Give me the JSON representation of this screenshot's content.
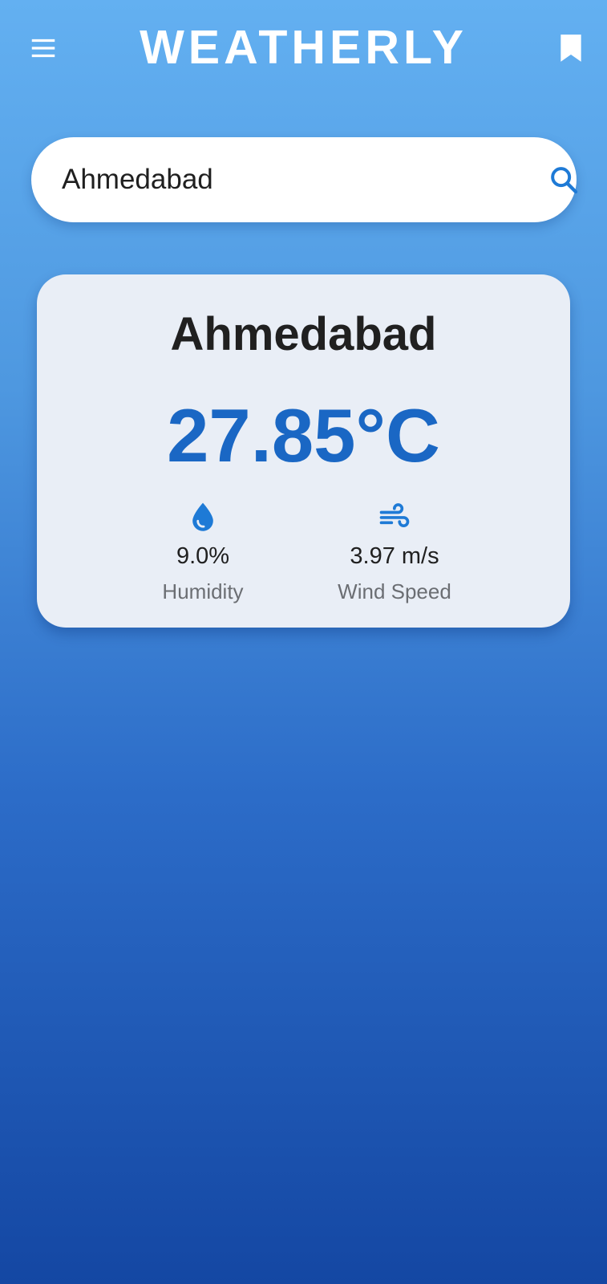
{
  "app": {
    "title": "WEATHERLY",
    "menu_icon": "menu-icon",
    "bookmark_icon": "bookmark-icon"
  },
  "search": {
    "value": "Ahmedabad",
    "icon": "search-icon"
  },
  "weather": {
    "city": "Ahmedabad",
    "temperature": "27.85°C",
    "humidity": {
      "value": "9.0%",
      "label": "Humidity",
      "icon": "water-drop-icon"
    },
    "wind": {
      "value": "3.97 m/s",
      "label": "Wind Speed",
      "icon": "wind-icon"
    }
  },
  "colors": {
    "gradient_top": "#63b0f1",
    "gradient_bottom": "#1447a3",
    "accent": "#1a67c4",
    "icon_blue": "#1e7ad6",
    "card_background": "#e9eef6"
  }
}
